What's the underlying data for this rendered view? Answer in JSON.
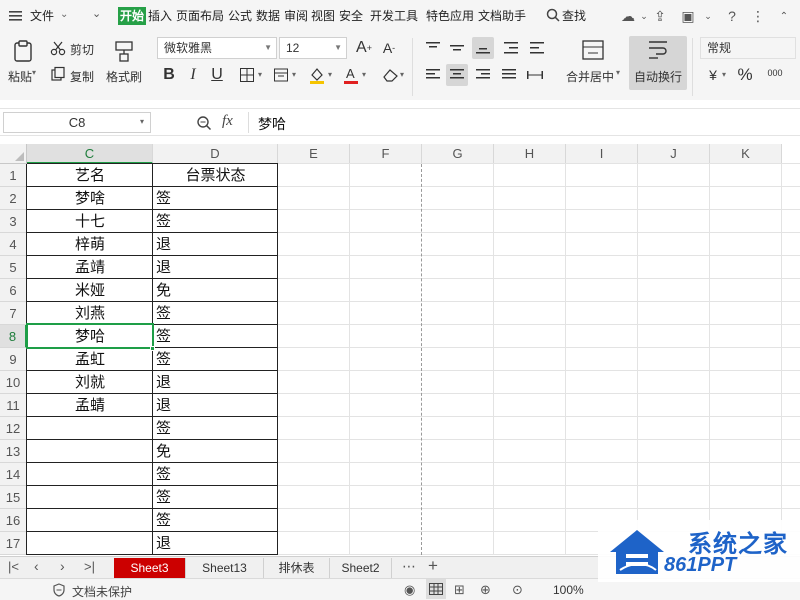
{
  "menu": {
    "file_label": "文件",
    "tabs": [
      "开始",
      "插入",
      "页面布局",
      "公式",
      "数据",
      "审阅",
      "视图",
      "安全",
      "开发工具",
      "特色应用",
      "文档助手"
    ],
    "active_tab": "开始",
    "search_label": "查找"
  },
  "ribbon": {
    "paste": "粘贴",
    "cut": "剪切",
    "copy": "复制",
    "format_painter": "格式刷",
    "font_name": "微软雅黑",
    "font_size": "12",
    "merge_center": "合并居中",
    "wrap_text": "自动换行",
    "number_format": "常规",
    "percent": "%",
    "thousands": "000",
    "bold": "B",
    "italic": "I",
    "underline": "U",
    "font_grow": "A",
    "font_shrink": "A"
  },
  "formula_bar": {
    "name_box": "C8",
    "fx_label": "fx",
    "value": "梦哈"
  },
  "sheet": {
    "columns": [
      "C",
      "D",
      "E",
      "F",
      "G",
      "H",
      "I",
      "J",
      "K"
    ],
    "selected_column": "C",
    "rows": [
      "1",
      "2",
      "3",
      "4",
      "5",
      "6",
      "7",
      "8",
      "9",
      "10",
      "11",
      "12",
      "13",
      "14",
      "15",
      "16",
      "17"
    ],
    "selected_row": "8",
    "header": {
      "name": "艺名",
      "status": "台票状态"
    },
    "data": [
      {
        "name": "梦啥",
        "status": "签"
      },
      {
        "name": "十七",
        "status": "签"
      },
      {
        "name": "梓萌",
        "status": "退"
      },
      {
        "name": "孟靖",
        "status": "退"
      },
      {
        "name": "米娅",
        "status": "免"
      },
      {
        "name": "刘燕",
        "status": "签"
      },
      {
        "name": "梦哈",
        "status": "签"
      },
      {
        "name": "孟虹",
        "status": "签"
      },
      {
        "name": "刘就",
        "status": "退"
      },
      {
        "name": "孟蜻",
        "status": "退"
      },
      {
        "name": "",
        "status": "签"
      },
      {
        "name": "",
        "status": "免"
      },
      {
        "name": "",
        "status": "签"
      },
      {
        "name": "",
        "status": "签"
      },
      {
        "name": "",
        "status": "签"
      },
      {
        "name": "",
        "status": "退"
      }
    ]
  },
  "sheet_tabs": [
    "Sheet3",
    "Sheet13",
    "排休表",
    "Sheet2"
  ],
  "active_sheet": "Sheet3",
  "status_bar": {
    "protect": "文档未保护",
    "zoom": "100%"
  },
  "watermark": {
    "title": "系统之家",
    "sub": "861PPT"
  },
  "colors": {
    "accent_green": "#26a047",
    "active_sheet_red": "#cc0000",
    "selection_green": "#1e9e47",
    "watermark_blue": "#1e63c8"
  }
}
